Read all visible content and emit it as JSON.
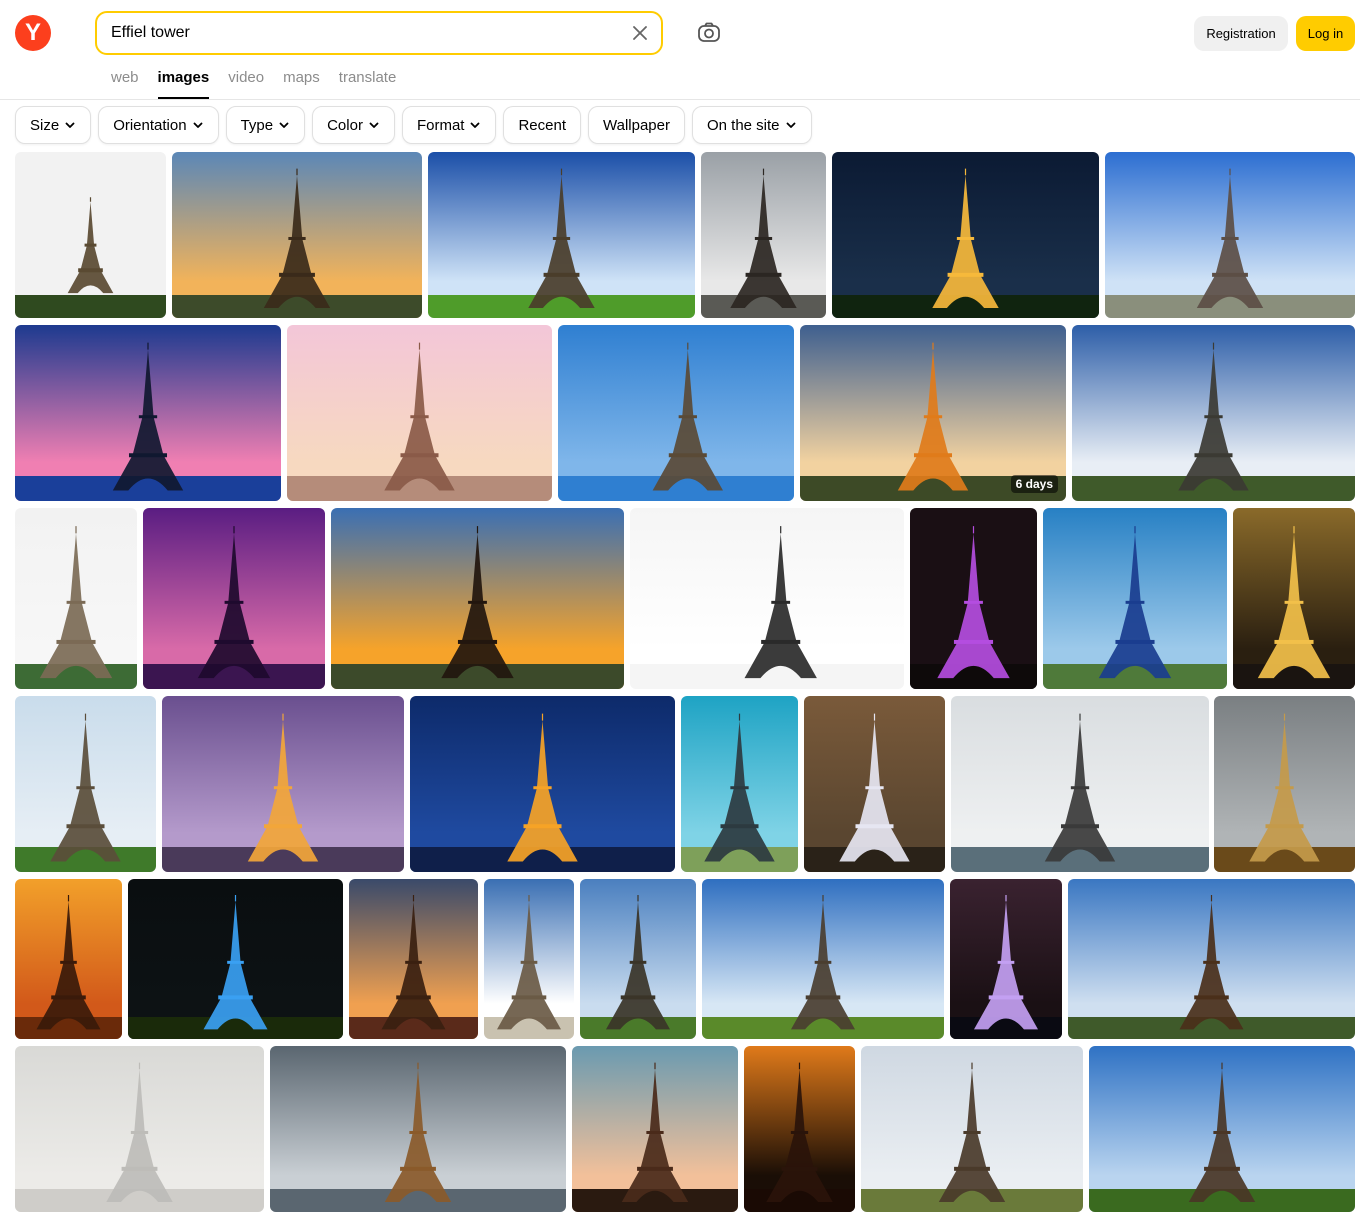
{
  "header": {
    "logo_letter": "Y",
    "search": {
      "value": "Effiel tower"
    },
    "tabs": [
      {
        "label": "web",
        "active": false
      },
      {
        "label": "images",
        "active": true
      },
      {
        "label": "video",
        "active": false
      },
      {
        "label": "maps",
        "active": false
      },
      {
        "label": "translate",
        "active": false
      }
    ],
    "registration_label": "Registration",
    "login_label": "Log in"
  },
  "filters": [
    {
      "label": "Size",
      "dropdown": true
    },
    {
      "label": "Orientation",
      "dropdown": true
    },
    {
      "label": "Type",
      "dropdown": true
    },
    {
      "label": "Color",
      "dropdown": true
    },
    {
      "label": "Format",
      "dropdown": true
    },
    {
      "label": "Recent",
      "dropdown": false
    },
    {
      "label": "Wallpaper",
      "dropdown": false
    },
    {
      "label": "On the site",
      "dropdown": true
    }
  ],
  "results": [
    {
      "scene": "white",
      "sky": [
        "#f2f2f2",
        "#f2f2f2"
      ],
      "tower": "#5a4a32",
      "ground": "#2f4a1f"
    },
    {
      "scene": "sunset-trees",
      "sky": [
        "#5b87b7",
        "#f2b35a"
      ],
      "tower": "#3a2a1a",
      "ground": "#3d4b2a"
    },
    {
      "scene": "clouds-lawn",
      "sky": [
        "#1b4fa8",
        "#cfe3f7"
      ],
      "tower": "#4a3d2a",
      "ground": "#4f9c2a"
    },
    {
      "scene": "gray-clouds",
      "sky": [
        "#9aa0a6",
        "#e8e8e8"
      ],
      "tower": "#2b2622",
      "ground": "#5a5a55"
    },
    {
      "scene": "night-lit",
      "sky": [
        "#0b1a33",
        "#1a2f4a"
      ],
      "tower": "#f6b93b",
      "ground": "#10240f"
    },
    {
      "scene": "blue-sky",
      "sky": [
        "#2c6ed1",
        "#cfe2f6"
      ],
      "tower": "#5c4e45",
      "ground": "#8a8f7c"
    },
    {
      "scene": "blue-dusk",
      "sky": [
        "#1d3a8f",
        "#f07fb2"
      ],
      "tower": "#101830",
      "ground": "#1a3f9a"
    },
    {
      "scene": "pink-city",
      "sky": [
        "#f3c6d8",
        "#f7d9c0"
      ],
      "tower": "#8a5a48",
      "ground": "#b58c7a"
    },
    {
      "scene": "low-angle",
      "sky": [
        "#2f7fd1",
        "#7fb6ea"
      ],
      "tower": "#5a4a36",
      "ground": "#2f7fd1"
    },
    {
      "scene": "orange-clouds",
      "sky": [
        "#3e5f8f",
        "#f2d2a0"
      ],
      "tower": "#e07b1a",
      "ground": "#3d4a26"
    },
    {
      "scene": "hdr-clouds",
      "sky": [
        "#2d5ea8",
        "#e8eef5"
      ],
      "tower": "#3b3a33",
      "ground": "#3f5a2a"
    },
    {
      "scene": "spring-tree",
      "sky": [
        "#f2f2f2",
        "#f7f7f7"
      ],
      "tower": "#7b6a55",
      "ground": "#3d6b35"
    },
    {
      "scene": "purple-sky",
      "sky": [
        "#5a1d82",
        "#d86aa8"
      ],
      "tower": "#1e0a2e",
      "ground": "#3b1550"
    },
    {
      "scene": "golden-sunset",
      "sky": [
        "#3a6fb3",
        "#f6a32a"
      ],
      "tower": "#22160e",
      "ground": "#3c4a2a"
    },
    {
      "scene": "bw-low",
      "sky": [
        "#f5f5f5",
        "#ffffff"
      ],
      "tower": "#2a2a2a",
      "ground": "#f5f5f5"
    },
    {
      "scene": "purple-night",
      "sky": [
        "#1a0f14",
        "#1a0f14"
      ],
      "tower": "#b44de0",
      "ground": "#0e0a0a"
    },
    {
      "scene": "cherry-blossom",
      "sky": [
        "#2780c4",
        "#9cc9ea"
      ],
      "tower": "#1a3d8f",
      "ground": "#4f7a3a"
    },
    {
      "scene": "gold-night",
      "sky": [
        "#8a6a2a",
        "#2a1f10"
      ],
      "tower": "#f2c04a",
      "ground": "#1a1410"
    },
    {
      "scene": "picnic",
      "sky": [
        "#c9dceb",
        "#e6eef5"
      ],
      "tower": "#5a4d3a",
      "ground": "#3f7a2a"
    },
    {
      "scene": "violet-plaza",
      "sky": [
        "#6a4f8f",
        "#b49acb"
      ],
      "tower": "#f2a63a",
      "ground": "#4a3a5a"
    },
    {
      "scene": "paris-night",
      "sky": [
        "#0d2a6a",
        "#1f4aa0"
      ],
      "tower": "#f6a326",
      "ground": "#0f1f4a"
    },
    {
      "scene": "teal-sky",
      "sky": [
        "#1ea3c4",
        "#7fd3e6"
      ],
      "tower": "#2c3a40",
      "ground": "#7ea05a"
    },
    {
      "scene": "light-show",
      "sky": [
        "#7a5a3a",
        "#5a4630"
      ],
      "tower": "#e6e6f2",
      "ground": "#2a2218"
    },
    {
      "scene": "river-columns",
      "sky": [
        "#d9dde0",
        "#eef0f1"
      ],
      "tower": "#3a3a3a",
      "ground": "#5a6f7a"
    },
    {
      "scene": "rainbow",
      "sky": [
        "#7a7f82",
        "#b0b4b6"
      ],
      "tower": "#c49a4a",
      "ground": "#6a4a1a"
    },
    {
      "scene": "quote-orange",
      "sky": [
        "#f2a02a",
        "#d2591a"
      ],
      "tower": "#3a1a0a",
      "ground": "#6a2a0a"
    },
    {
      "scene": "blue-lit",
      "sky": [
        "#0a0e10",
        "#0d1214"
      ],
      "tower": "#3aa0f2",
      "ground": "#1a2a0a"
    },
    {
      "scene": "rooftops",
      "sky": [
        "#3a4a6a",
        "#f0a050"
      ],
      "tower": "#3a2010",
      "ground": "#5a2a1a"
    },
    {
      "scene": "under-tower",
      "sky": [
        "#3a6fb3",
        "#ffffff"
      ],
      "tower": "#6a5a45",
      "ground": "#c9c2b0"
    },
    {
      "scene": "park-afternoon",
      "sky": [
        "#4a7fbf",
        "#c9dcef"
      ],
      "tower": "#3a3428",
      "ground": "#4a7a2a"
    },
    {
      "scene": "lawn-clouds",
      "sky": [
        "#2f6fc0",
        "#d7e7f5"
      ],
      "tower": "#4a3e30",
      "ground": "#5a8a2a"
    },
    {
      "scene": "purple-lit",
      "sky": [
        "#3a2230",
        "#1a1014"
      ],
      "tower": "#c3a0f2",
      "ground": "#0a0a12"
    },
    {
      "scene": "contrails",
      "sky": [
        "#3a77c2",
        "#cfdff0"
      ],
      "tower": "#4a2f1a",
      "ground": "#3f5a2a"
    },
    {
      "scene": "fog",
      "sky": [
        "#d9d9d6",
        "#ecebe8"
      ],
      "tower": "#bdbcb8",
      "ground": "#cfcdc9"
    },
    {
      "scene": "bronze-arch",
      "sky": [
        "#5a6670",
        "#c9cfd4"
      ],
      "tower": "#8a5a2a",
      "ground": "#5a6670"
    },
    {
      "scene": "leaf-frame",
      "sky": [
        "#6a9ab0",
        "#f2c09a"
      ],
      "tower": "#4a2a1a",
      "ground": "#2a1a10"
    },
    {
      "scene": "dark-orange",
      "sky": [
        "#e07a1a",
        "#1a0e06"
      ],
      "tower": "#2a140a",
      "ground": "#1a0a04"
    },
    {
      "scene": "two-men",
      "sky": [
        "#cfd8e2",
        "#eaeef2"
      ],
      "tower": "#4a3a2a",
      "ground": "#6a7a3a"
    },
    {
      "scene": "green-park",
      "sky": [
        "#2f72c4",
        "#b9d4ef"
      ],
      "tower": "#4a3626",
      "ground": "#3a6a1f"
    }
  ],
  "badge": "6 days"
}
